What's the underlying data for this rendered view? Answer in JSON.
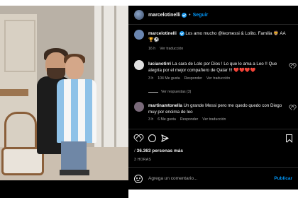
{
  "header": {
    "username": "marcelotinelli",
    "separator": "•",
    "follow_label": "Seguir"
  },
  "comments": [
    {
      "username": "marcelotinelli",
      "text": "Los amo mucho @leomessi & Lolito. Familia 🦁 AA🏆⚽",
      "meta": [
        "16 h",
        "Ver traducción"
      ],
      "avatar_color": "#6a86b0"
    },
    {
      "username": "lucianotirri",
      "text": "La cara de Lolo por Dios ! Lo que lo ama a Leo !! Que alegría por el mejor compañero de Qatar !!! ❤️❤️❤️❤️",
      "meta": [
        "3 h",
        "104 Me gusta",
        "Responder",
        "Ver traducción"
      ],
      "avatar_color": "#d9d9d9"
    },
    {
      "username": "martinamtonella",
      "text": "Un grande Messi pero me quedo quedo con Diego muy por encima de leo",
      "meta": [
        "3 h",
        "6 Me gusta",
        "Responder",
        "Ver traducción"
      ],
      "avatar_color": "#7a6a7a"
    }
  ],
  "replies_label": "Ver respuestas (3)",
  "likes": {
    "prefix": "/",
    "count": "36.363 personas más"
  },
  "date": "3 HORAS",
  "comment_box": {
    "placeholder": "Agrega un comentario...",
    "publish_label": "Publicar"
  },
  "colors": {
    "accent": "#0095f6",
    "panel_bg": "#000000",
    "muted": "#a8a8a8"
  },
  "icons": [
    "heart-icon",
    "comment-icon",
    "share-icon",
    "bookmark-icon",
    "emoji-icon",
    "verified-icon"
  ]
}
